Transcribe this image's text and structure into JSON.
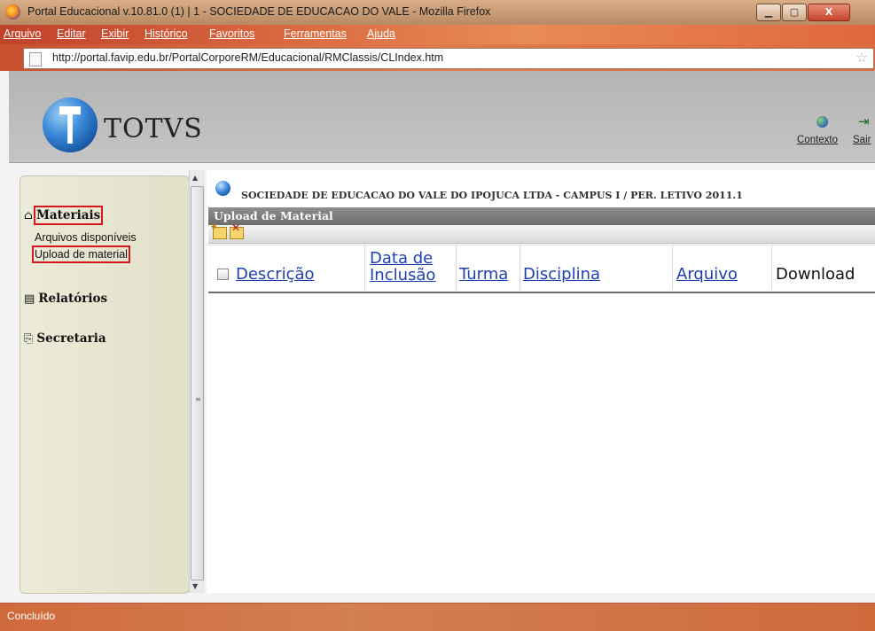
{
  "window": {
    "title": "Portal Educacional v.10.81.0 (1) | 1 - SOCIEDADE DE EDUCACAO DO VALE - Mozilla Firefox",
    "minimize_glyph": "▁",
    "maximize_glyph": "▢",
    "close_glyph": "X"
  },
  "menu": {
    "items": [
      "Arquivo",
      "Editar",
      "Exibir",
      "Histórico",
      "Favoritos",
      "Ferramentas",
      "Ajuda"
    ]
  },
  "address": {
    "url": "http://portal.favip.edu.br/PortalCorporeRM/Educacional/RMClassis/CLIndex.htm"
  },
  "header": {
    "logo_text": "TOTVS",
    "contexto_label": "Contexto",
    "sair_label": "Sair"
  },
  "sidebar": {
    "sections": [
      {
        "label": "Materiais",
        "icon": "briefcase-icon",
        "items": [
          "Arquivos disponíveis",
          "Upload de material"
        ]
      },
      {
        "label": "Relatórios",
        "icon": "report-icon"
      },
      {
        "label": "Secretaria",
        "icon": "secretary-icon"
      }
    ]
  },
  "main": {
    "org_line": "SOCIEDADE DE EDUCACAO DO VALE DO IPOJUCA LTDA - CAMPUS I / PER. LETIVO 2011.1",
    "panel_title": "Upload de Material",
    "columns": {
      "descricao": "Descrição",
      "data_inclusao_1": "Data de",
      "data_inclusao_2": "Inclusão",
      "turma": "Turma",
      "disciplina": "Disciplina",
      "arquivo": "Arquivo",
      "download": "Download"
    }
  },
  "status": {
    "text": "Concluído"
  },
  "colors": {
    "highlight_box": "#d4161d",
    "link": "#1e3fb0",
    "panel_title_bg": "#7a7a7a"
  }
}
